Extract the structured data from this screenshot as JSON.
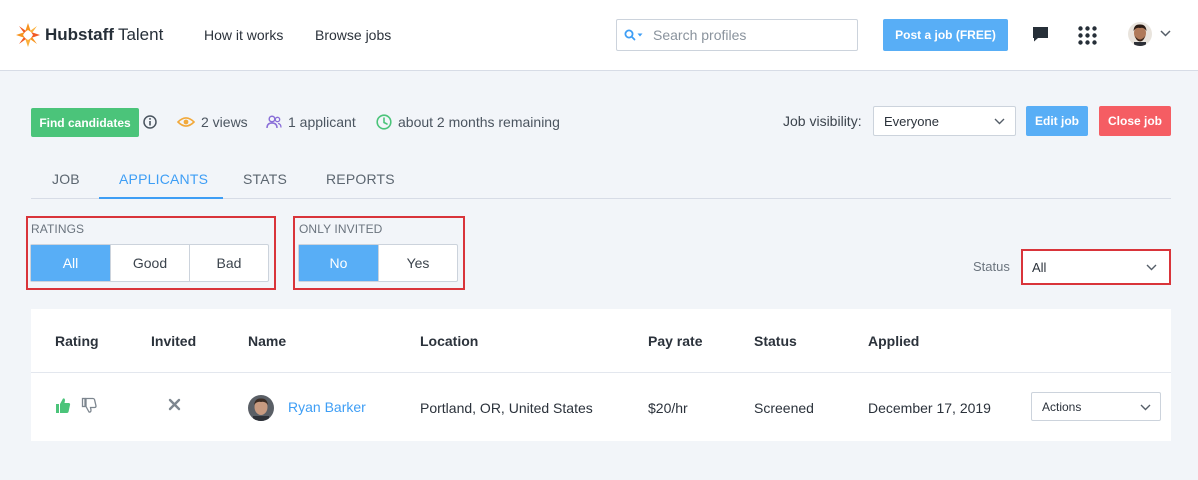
{
  "header": {
    "logo_name": "Hubstaff",
    "logo_suffix": "Talent",
    "nav": [
      "How it works",
      "Browse jobs"
    ],
    "search_placeholder": "Search profiles",
    "post_job_label": "Post a job (FREE)",
    "icons": [
      "chat-icon",
      "apps-grid-icon",
      "avatar",
      "chevron-down-icon"
    ]
  },
  "job_bar": {
    "find_candidates_label": "Find candidates",
    "views": "2 views",
    "applicants": "1 applicant",
    "remaining": "about 2 months remaining",
    "visibility_label": "Job visibility:",
    "visibility_value": "Everyone",
    "edit_label": "Edit job",
    "close_label": "Close job"
  },
  "tabs": [
    {
      "label": "JOB",
      "active": false
    },
    {
      "label": "APPLICANTS",
      "active": true
    },
    {
      "label": "STATS",
      "active": false
    },
    {
      "label": "REPORTS",
      "active": false
    }
  ],
  "filters": {
    "ratings": {
      "label": "RATINGS",
      "options": [
        "All",
        "Good",
        "Bad"
      ],
      "selected": "All"
    },
    "only_invited": {
      "label": "ONLY INVITED",
      "options": [
        "No",
        "Yes"
      ],
      "selected": "No"
    },
    "status": {
      "label": "Status",
      "value": "All"
    }
  },
  "table": {
    "columns": [
      "Rating",
      "Invited",
      "Name",
      "Location",
      "Pay rate",
      "Status",
      "Applied"
    ],
    "rows": [
      {
        "name": "Ryan Barker",
        "location": "Portland, OR, United States",
        "pay_rate": "$20/hr",
        "status": "Screened",
        "applied": "December 17, 2019",
        "actions_label": "Actions"
      }
    ]
  },
  "colors": {
    "primary": "#58aef6",
    "success": "#4bc47a",
    "danger": "#f55d63",
    "highlight_border": "#d9343a"
  }
}
